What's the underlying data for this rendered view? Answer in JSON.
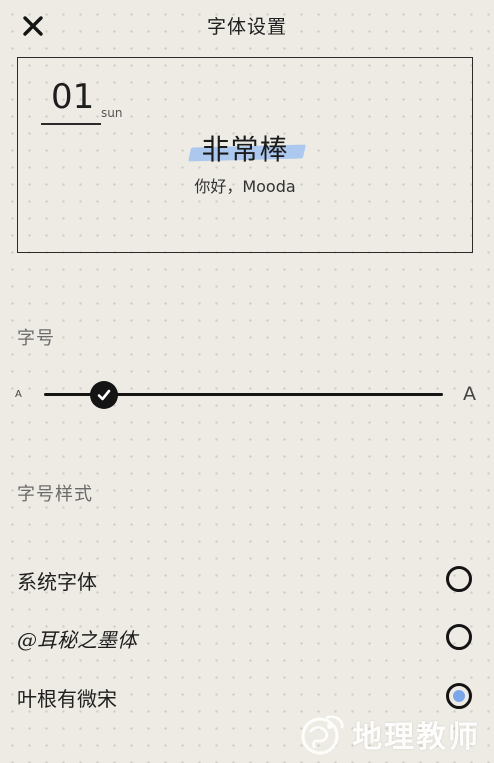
{
  "header": {
    "title": "字体设置",
    "close_icon": "close-icon"
  },
  "preview": {
    "date_number": "01",
    "date_day": "sun",
    "title": "非常棒",
    "subtitle": "你好，Mooda",
    "highlight_color": "#a9c6ee"
  },
  "font_size": {
    "label": "字号",
    "small_label": "A",
    "large_label": "A",
    "level": 0.15
  },
  "font_style": {
    "label": "字号样式",
    "options": [
      {
        "label": "系统字体",
        "selected": false
      },
      {
        "label": "@耳秘之墨体",
        "selected": false
      },
      {
        "label": "叶根有微宋",
        "selected": true
      }
    ],
    "selected_color": "#7ba7e8"
  },
  "watermark": {
    "text": "地理教师"
  }
}
